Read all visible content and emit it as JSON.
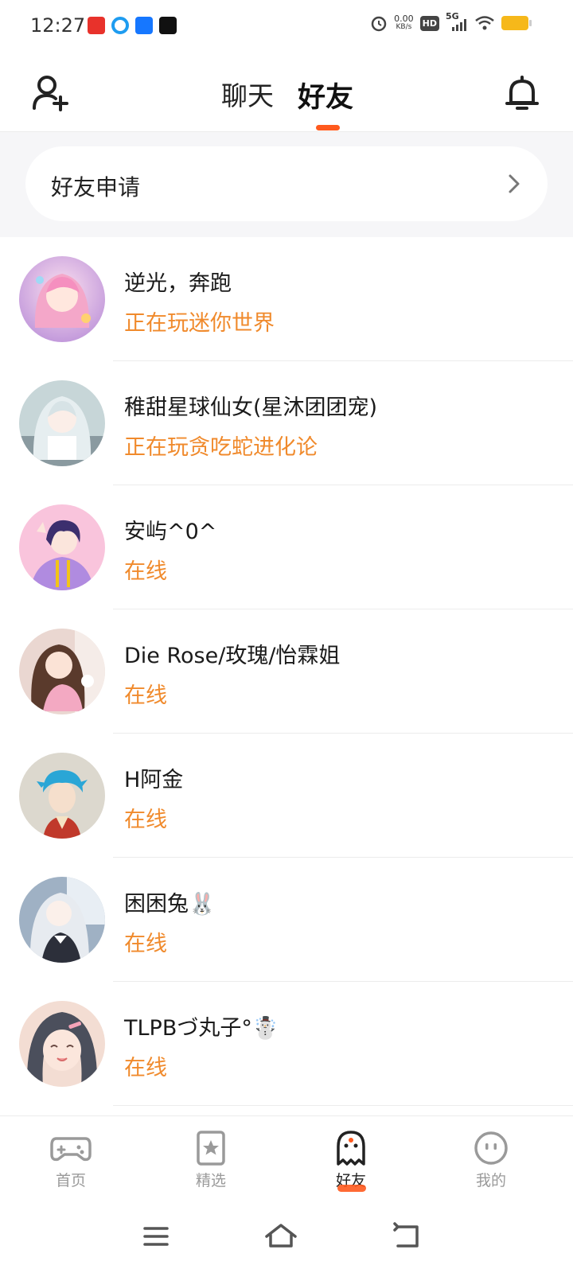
{
  "status_bar": {
    "time": "12:27",
    "net_speed_value": "0.00",
    "net_speed_unit": "KB/s",
    "hd": "HD",
    "network": "5G",
    "icons": [
      "headline-app-icon",
      "browser-app-icon",
      "alipay-app-icon",
      "tiktok-app-icon",
      "alarm-icon",
      "signal-icon",
      "wifi-icon",
      "battery-icon"
    ]
  },
  "header": {
    "tabs": [
      {
        "label": "聊天",
        "active": false
      },
      {
        "label": "好友",
        "active": true
      }
    ],
    "accent_color": "#ff5a1e"
  },
  "friend_request": {
    "label": "好友申请"
  },
  "friends": [
    {
      "name": "逆光，奔跑",
      "status": "正在玩迷你世界"
    },
    {
      "name": "稚甜星球仙女(星沐团团宠)",
      "status": "正在玩贪吃蛇进化论"
    },
    {
      "name": "安屿^0^",
      "status": "在线"
    },
    {
      "name": "Die Rose/玫瑰/怡霖姐",
      "status": "在线"
    },
    {
      "name": "H阿金",
      "status": "在线"
    },
    {
      "name": "困困兔🐰",
      "status": "在线"
    },
    {
      "name": "TLPBづ丸子°☃️",
      "status": "在线"
    }
  ],
  "status_color": "#f08a2c",
  "bottom_nav": {
    "items": [
      {
        "label": "首页",
        "icon": "gamepad-icon",
        "active": false
      },
      {
        "label": "精选",
        "icon": "star-card-icon",
        "active": false
      },
      {
        "label": "好友",
        "icon": "ghost-icon",
        "active": true
      },
      {
        "label": "我的",
        "icon": "face-icon",
        "active": false
      }
    ]
  }
}
